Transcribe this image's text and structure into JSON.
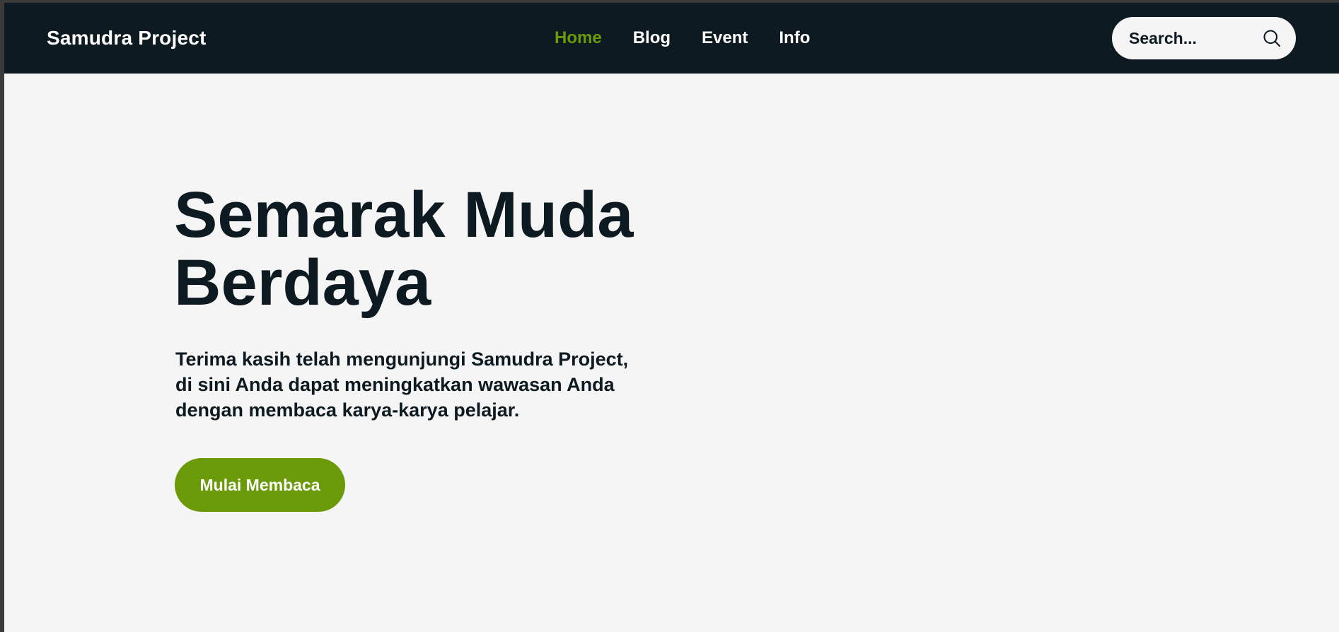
{
  "colors": {
    "navbar_bg": "#0d1a21",
    "accent": "#6b9a09",
    "page_bg": "#f5f5f5",
    "text_dark": "#0d1a21",
    "text_light": "#ffffff"
  },
  "header": {
    "brand": "Samudra Project",
    "nav": [
      {
        "label": "Home",
        "active": true
      },
      {
        "label": "Blog",
        "active": false
      },
      {
        "label": "Event",
        "active": false
      },
      {
        "label": "Info",
        "active": false
      }
    ],
    "search": {
      "placeholder": "Search...",
      "value": "",
      "icon": "search-icon"
    }
  },
  "hero": {
    "title_lines": [
      "Semarak Muda",
      "Berdaya"
    ],
    "description_lines": [
      "Terima kasih telah mengunjungi Samudra Project,",
      "di sini Anda dapat meningkatkan wawasan Anda",
      "dengan membaca karya-karya pelajar."
    ],
    "cta_label": "Mulai Membaca"
  }
}
